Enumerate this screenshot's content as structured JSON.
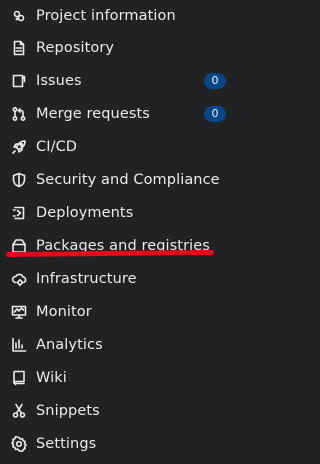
{
  "sidebar": {
    "items": [
      {
        "label": "Project information",
        "icon": "project-icon"
      },
      {
        "label": "Repository",
        "icon": "document-icon"
      },
      {
        "label": "Issues",
        "icon": "issues-icon",
        "badge": "0"
      },
      {
        "label": "Merge requests",
        "icon": "merge-request-icon",
        "badge": "0"
      },
      {
        "label": "CI/CD",
        "icon": "rocket-icon"
      },
      {
        "label": "Security and Compliance",
        "icon": "shield-icon"
      },
      {
        "label": "Deployments",
        "icon": "deployments-icon"
      },
      {
        "label": "Packages and registries",
        "icon": "package-icon"
      },
      {
        "label": "Infrastructure",
        "icon": "cloud-gear-icon"
      },
      {
        "label": "Monitor",
        "icon": "monitor-icon"
      },
      {
        "label": "Analytics",
        "icon": "chart-icon"
      },
      {
        "label": "Wiki",
        "icon": "book-icon"
      },
      {
        "label": "Snippets",
        "icon": "scissors-icon"
      },
      {
        "label": "Settings",
        "icon": "gear-icon"
      }
    ]
  },
  "colors": {
    "background": "#222124",
    "text": "#ececef",
    "badge_bg": "#064787",
    "annotation_red": "#e4061b"
  }
}
